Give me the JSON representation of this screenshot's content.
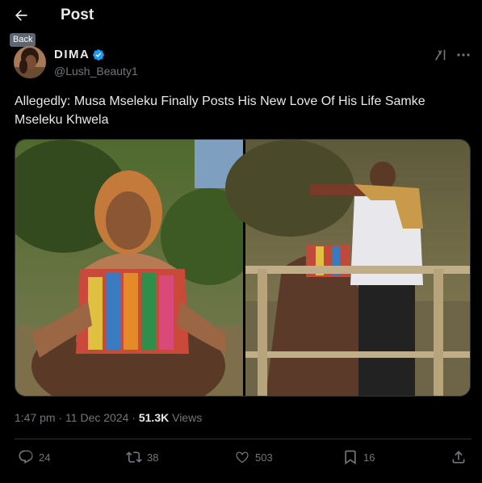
{
  "header": {
    "title": "Post",
    "back_tooltip": "Back"
  },
  "author": {
    "display_name": "DIMA",
    "handle": "@Lush_Beauty1",
    "verified": true
  },
  "tweet": {
    "text": "Allegedly: Musa Mseleku Finally Posts His New Love Of His Life Samke Mseleku Khwela"
  },
  "meta": {
    "time": "1:47 pm",
    "separator": "·",
    "date": "11 Dec 2024",
    "views_count": "51.3K",
    "views_label": "Views"
  },
  "actions": {
    "replies": "24",
    "reposts": "38",
    "likes": "503",
    "bookmarks": "16"
  },
  "icons": [
    "back-arrow-icon",
    "verified-badge-icon",
    "grok-icon",
    "more-icon",
    "reply-icon",
    "repost-icon",
    "like-icon",
    "bookmark-icon",
    "share-icon"
  ],
  "colors": {
    "background": "#000000",
    "text": "#e7e9ea",
    "secondary": "#71767b",
    "verified": "#1d9bf0",
    "divider": "#2f3336"
  }
}
